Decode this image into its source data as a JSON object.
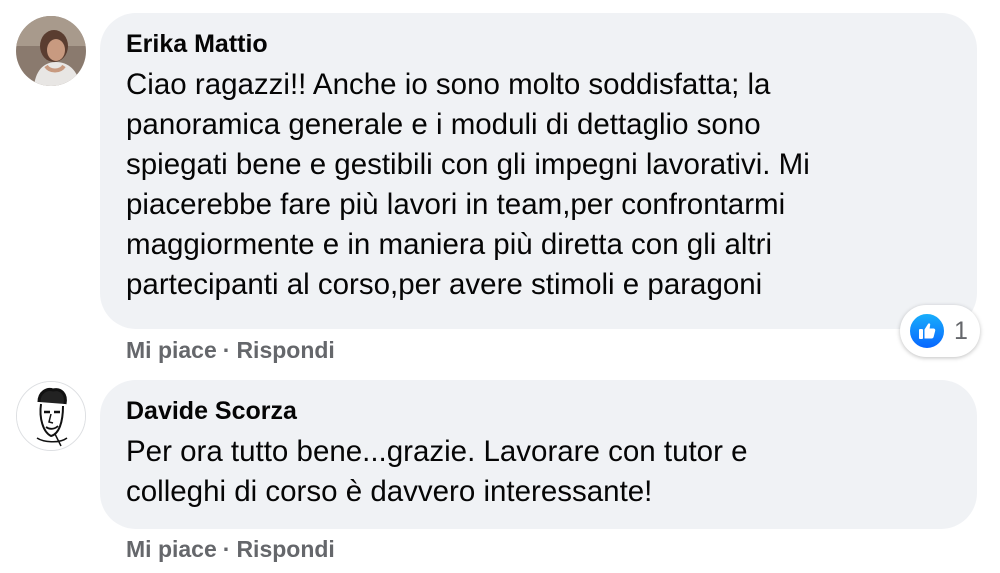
{
  "comments": [
    {
      "author": "Erika Mattio",
      "text_lines": [
        "Ciao ragazzi!! Anche io sono molto soddisfatta; la",
        "panoramica generale e i moduli di dettaglio sono",
        "spiegati bene e gestibili con gli impegni lavorativi. Mi",
        "piacerebbe fare più lavori in team,per confrontarmi",
        "maggiormente e in maniera più diretta con gli altri",
        "partecipanti al corso,per avere stimoli e paragoni"
      ],
      "like_label": "Mi piace",
      "separator": "·",
      "reply_label": "Rispondi",
      "reaction": {
        "icon": "like-icon",
        "count": "1",
        "color": "#0866ff"
      }
    },
    {
      "author": "Davide Scorza",
      "text_lines": [
        "Per ora tutto bene...grazie. Lavorare con tutor e",
        "colleghi di corso è davvero interessante!"
      ],
      "like_label": "Mi piace",
      "separator": "·",
      "reply_label": "Rispondi"
    }
  ],
  "colors": {
    "bubble_bg": "#f0f2f5",
    "text": "#050505",
    "secondary_text": "#65676b",
    "like_blue": "#0866ff"
  }
}
